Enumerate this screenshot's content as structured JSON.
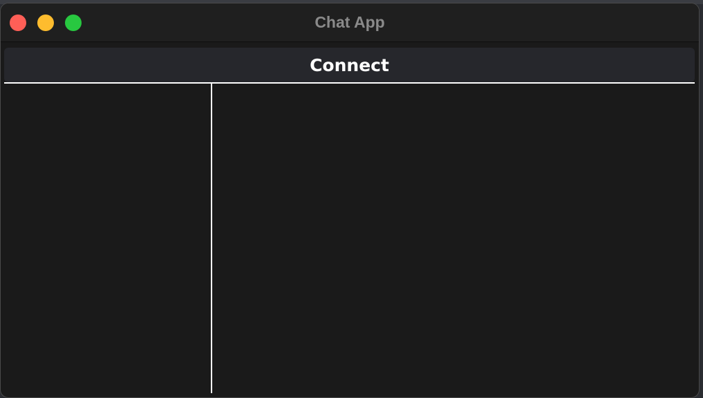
{
  "window": {
    "title": "Chat App",
    "controls": {
      "close_color": "#ff5f57",
      "minimize_color": "#febc2e",
      "zoom_color": "#28c840"
    }
  },
  "toolbar": {
    "connect_label": "Connect"
  },
  "sidebar": {
    "items": []
  },
  "chat": {
    "messages": []
  }
}
